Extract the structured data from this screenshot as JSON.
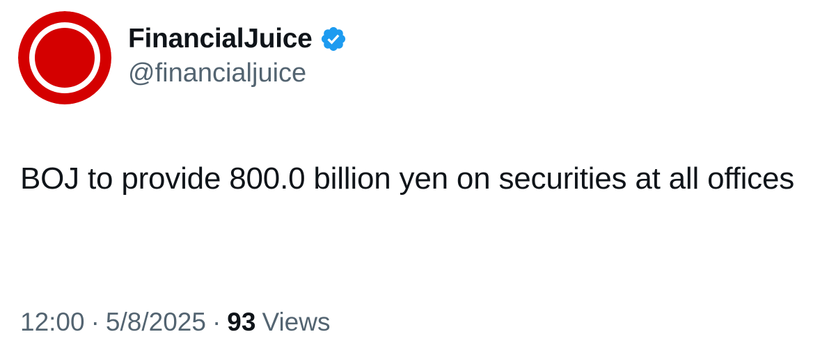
{
  "author": {
    "display_name": "FinancialJuice",
    "handle": "@financialjuice",
    "verified": true,
    "avatar_icon": "red-circle-logo-icon",
    "verified_icon": "verified-badge-icon"
  },
  "tweet": {
    "text": "BOJ to provide 800.0 billion yen on securities at all offices"
  },
  "meta": {
    "time": "12:00",
    "date": "5/8/2025",
    "separator": "·",
    "views_count": "93",
    "views_label": "Views"
  },
  "colors": {
    "logo_red": "#d40000",
    "logo_ring": "#ffffff",
    "verified_blue": "#1d9bf0",
    "text_primary": "#0f1419",
    "text_secondary": "#536471"
  }
}
